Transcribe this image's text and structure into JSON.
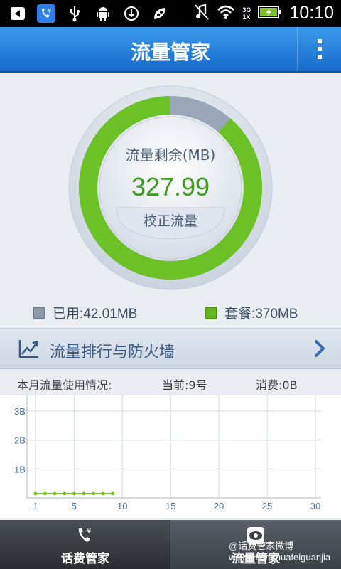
{
  "status_bar": {
    "time": "10:10",
    "network_3g": "3G",
    "network_1x": "1X",
    "icons": [
      "back-icon",
      "phone-app-icon",
      "usb-icon",
      "android-debug-icon",
      "download-icon",
      "pea-icon",
      "no-signal-note-icon",
      "wifi-icon",
      "signal-icon",
      "battery-charging-icon"
    ]
  },
  "title_bar": {
    "title": "流量管家",
    "menu_icon": "more-vertical-icon"
  },
  "gauge": {
    "label": "流量剩余(MB)",
    "value": "327.99",
    "calibrate_button": "校正流量",
    "remaining_fraction": 0.8865,
    "used_color": "#9aa7b8",
    "remaining_color": "#6cc126"
  },
  "legend": {
    "used_label": "已用:42.01MB",
    "plan_label": "套餐:370MB",
    "used_color": "#8f9aa8",
    "plan_color": "#64b51f"
  },
  "ranking": {
    "label": "流量排行与防火墙",
    "icon": "trend-chart-icon",
    "chevron": "chevron-right-icon"
  },
  "usage": {
    "title": "本月流量使用情况:",
    "current": "当前:9号",
    "cost": "消费:0B"
  },
  "chart_data": {
    "type": "line",
    "x": [
      1,
      2,
      3,
      4,
      5,
      6,
      7,
      8,
      9
    ],
    "series": [
      {
        "values": [
          0,
          0,
          0,
          0,
          0,
          0,
          0,
          0,
          0
        ]
      }
    ],
    "x_ticks": [
      "1",
      "5",
      "10",
      "15",
      "20",
      "25",
      "30"
    ],
    "y_ticks": [
      "1B",
      "2B",
      "3B"
    ],
    "xlim": [
      1,
      30
    ],
    "ylim": [
      0,
      3
    ],
    "grid": true,
    "line_color": "#7cc230"
  },
  "bottom_nav": {
    "tabs": [
      {
        "label": "话费管家",
        "icon": "phone-yuan-icon"
      },
      {
        "label": "流量管家",
        "icon": "traffic-eye-icon"
      }
    ],
    "watermark_line1": "@话费管家微博",
    "watermark_line2": "weibo.com/huafeiguanjia"
  }
}
